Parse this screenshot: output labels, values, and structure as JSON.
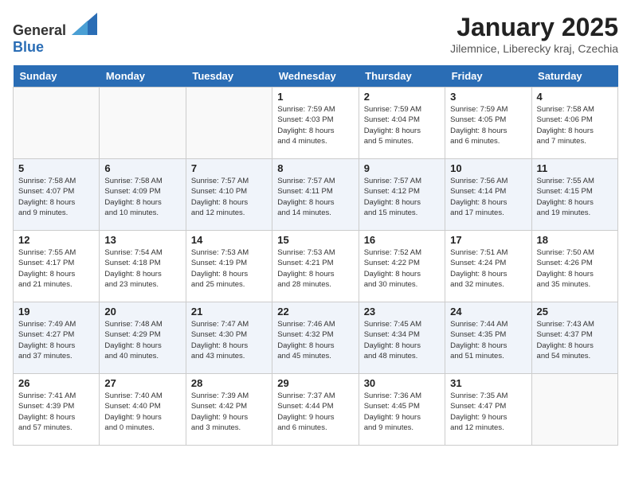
{
  "header": {
    "logo_general": "General",
    "logo_blue": "Blue",
    "title": "January 2025",
    "subtitle": "Jilemnice, Liberecky kraj, Czechia"
  },
  "days_of_week": [
    "Sunday",
    "Monday",
    "Tuesday",
    "Wednesday",
    "Thursday",
    "Friday",
    "Saturday"
  ],
  "weeks": [
    [
      {
        "num": "",
        "info": ""
      },
      {
        "num": "",
        "info": ""
      },
      {
        "num": "",
        "info": ""
      },
      {
        "num": "1",
        "info": "Sunrise: 7:59 AM\nSunset: 4:03 PM\nDaylight: 8 hours\nand 4 minutes."
      },
      {
        "num": "2",
        "info": "Sunrise: 7:59 AM\nSunset: 4:04 PM\nDaylight: 8 hours\nand 5 minutes."
      },
      {
        "num": "3",
        "info": "Sunrise: 7:59 AM\nSunset: 4:05 PM\nDaylight: 8 hours\nand 6 minutes."
      },
      {
        "num": "4",
        "info": "Sunrise: 7:58 AM\nSunset: 4:06 PM\nDaylight: 8 hours\nand 7 minutes."
      }
    ],
    [
      {
        "num": "5",
        "info": "Sunrise: 7:58 AM\nSunset: 4:07 PM\nDaylight: 8 hours\nand 9 minutes."
      },
      {
        "num": "6",
        "info": "Sunrise: 7:58 AM\nSunset: 4:09 PM\nDaylight: 8 hours\nand 10 minutes."
      },
      {
        "num": "7",
        "info": "Sunrise: 7:57 AM\nSunset: 4:10 PM\nDaylight: 8 hours\nand 12 minutes."
      },
      {
        "num": "8",
        "info": "Sunrise: 7:57 AM\nSunset: 4:11 PM\nDaylight: 8 hours\nand 14 minutes."
      },
      {
        "num": "9",
        "info": "Sunrise: 7:57 AM\nSunset: 4:12 PM\nDaylight: 8 hours\nand 15 minutes."
      },
      {
        "num": "10",
        "info": "Sunrise: 7:56 AM\nSunset: 4:14 PM\nDaylight: 8 hours\nand 17 minutes."
      },
      {
        "num": "11",
        "info": "Sunrise: 7:55 AM\nSunset: 4:15 PM\nDaylight: 8 hours\nand 19 minutes."
      }
    ],
    [
      {
        "num": "12",
        "info": "Sunrise: 7:55 AM\nSunset: 4:17 PM\nDaylight: 8 hours\nand 21 minutes."
      },
      {
        "num": "13",
        "info": "Sunrise: 7:54 AM\nSunset: 4:18 PM\nDaylight: 8 hours\nand 23 minutes."
      },
      {
        "num": "14",
        "info": "Sunrise: 7:53 AM\nSunset: 4:19 PM\nDaylight: 8 hours\nand 25 minutes."
      },
      {
        "num": "15",
        "info": "Sunrise: 7:53 AM\nSunset: 4:21 PM\nDaylight: 8 hours\nand 28 minutes."
      },
      {
        "num": "16",
        "info": "Sunrise: 7:52 AM\nSunset: 4:22 PM\nDaylight: 8 hours\nand 30 minutes."
      },
      {
        "num": "17",
        "info": "Sunrise: 7:51 AM\nSunset: 4:24 PM\nDaylight: 8 hours\nand 32 minutes."
      },
      {
        "num": "18",
        "info": "Sunrise: 7:50 AM\nSunset: 4:26 PM\nDaylight: 8 hours\nand 35 minutes."
      }
    ],
    [
      {
        "num": "19",
        "info": "Sunrise: 7:49 AM\nSunset: 4:27 PM\nDaylight: 8 hours\nand 37 minutes."
      },
      {
        "num": "20",
        "info": "Sunrise: 7:48 AM\nSunset: 4:29 PM\nDaylight: 8 hours\nand 40 minutes."
      },
      {
        "num": "21",
        "info": "Sunrise: 7:47 AM\nSunset: 4:30 PM\nDaylight: 8 hours\nand 43 minutes."
      },
      {
        "num": "22",
        "info": "Sunrise: 7:46 AM\nSunset: 4:32 PM\nDaylight: 8 hours\nand 45 minutes."
      },
      {
        "num": "23",
        "info": "Sunrise: 7:45 AM\nSunset: 4:34 PM\nDaylight: 8 hours\nand 48 minutes."
      },
      {
        "num": "24",
        "info": "Sunrise: 7:44 AM\nSunset: 4:35 PM\nDaylight: 8 hours\nand 51 minutes."
      },
      {
        "num": "25",
        "info": "Sunrise: 7:43 AM\nSunset: 4:37 PM\nDaylight: 8 hours\nand 54 minutes."
      }
    ],
    [
      {
        "num": "26",
        "info": "Sunrise: 7:41 AM\nSunset: 4:39 PM\nDaylight: 8 hours\nand 57 minutes."
      },
      {
        "num": "27",
        "info": "Sunrise: 7:40 AM\nSunset: 4:40 PM\nDaylight: 9 hours\nand 0 minutes."
      },
      {
        "num": "28",
        "info": "Sunrise: 7:39 AM\nSunset: 4:42 PM\nDaylight: 9 hours\nand 3 minutes."
      },
      {
        "num": "29",
        "info": "Sunrise: 7:37 AM\nSunset: 4:44 PM\nDaylight: 9 hours\nand 6 minutes."
      },
      {
        "num": "30",
        "info": "Sunrise: 7:36 AM\nSunset: 4:45 PM\nDaylight: 9 hours\nand 9 minutes."
      },
      {
        "num": "31",
        "info": "Sunrise: 7:35 AM\nSunset: 4:47 PM\nDaylight: 9 hours\nand 12 minutes."
      },
      {
        "num": "",
        "info": ""
      }
    ]
  ]
}
